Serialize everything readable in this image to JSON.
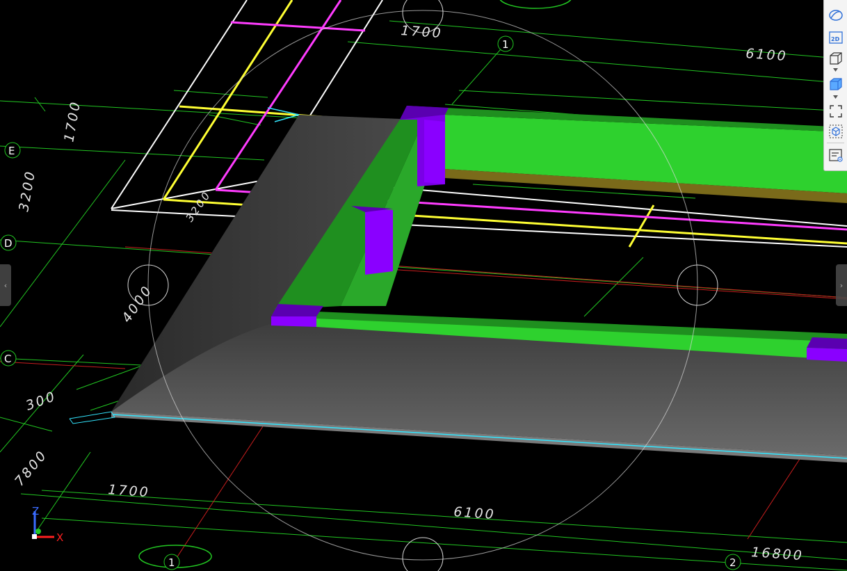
{
  "viewport": {
    "dimensions": [
      "1700",
      "6100",
      "1700",
      "3200",
      "1700",
      "4000",
      "7800",
      "1700",
      "6100",
      "16800",
      "3200",
      "300"
    ],
    "grid_labels": [
      "E",
      "D",
      "C",
      "1",
      "1",
      "2"
    ],
    "axis": {
      "x": "X",
      "z": "Z"
    }
  },
  "toolbar": {
    "buttons": [
      {
        "icon": "orbit-icon"
      },
      {
        "icon": "view-2d-icon",
        "label": "2D"
      },
      {
        "icon": "wireframe-cube-icon"
      },
      {
        "icon": "shaded-cube-icon"
      },
      {
        "icon": "zoom-extents-icon"
      },
      {
        "icon": "view-cube-icon"
      },
      {
        "icon": "properties-panel-icon"
      }
    ]
  },
  "colors": {
    "background": "#000000",
    "grid_line": "#22c722",
    "slab": "#5a5a5a",
    "beam": "#2ed12e",
    "column": "#8a00ff",
    "magenta": "#ff3cff",
    "yellow": "#ffff33",
    "cyan": "#33e6ff"
  }
}
